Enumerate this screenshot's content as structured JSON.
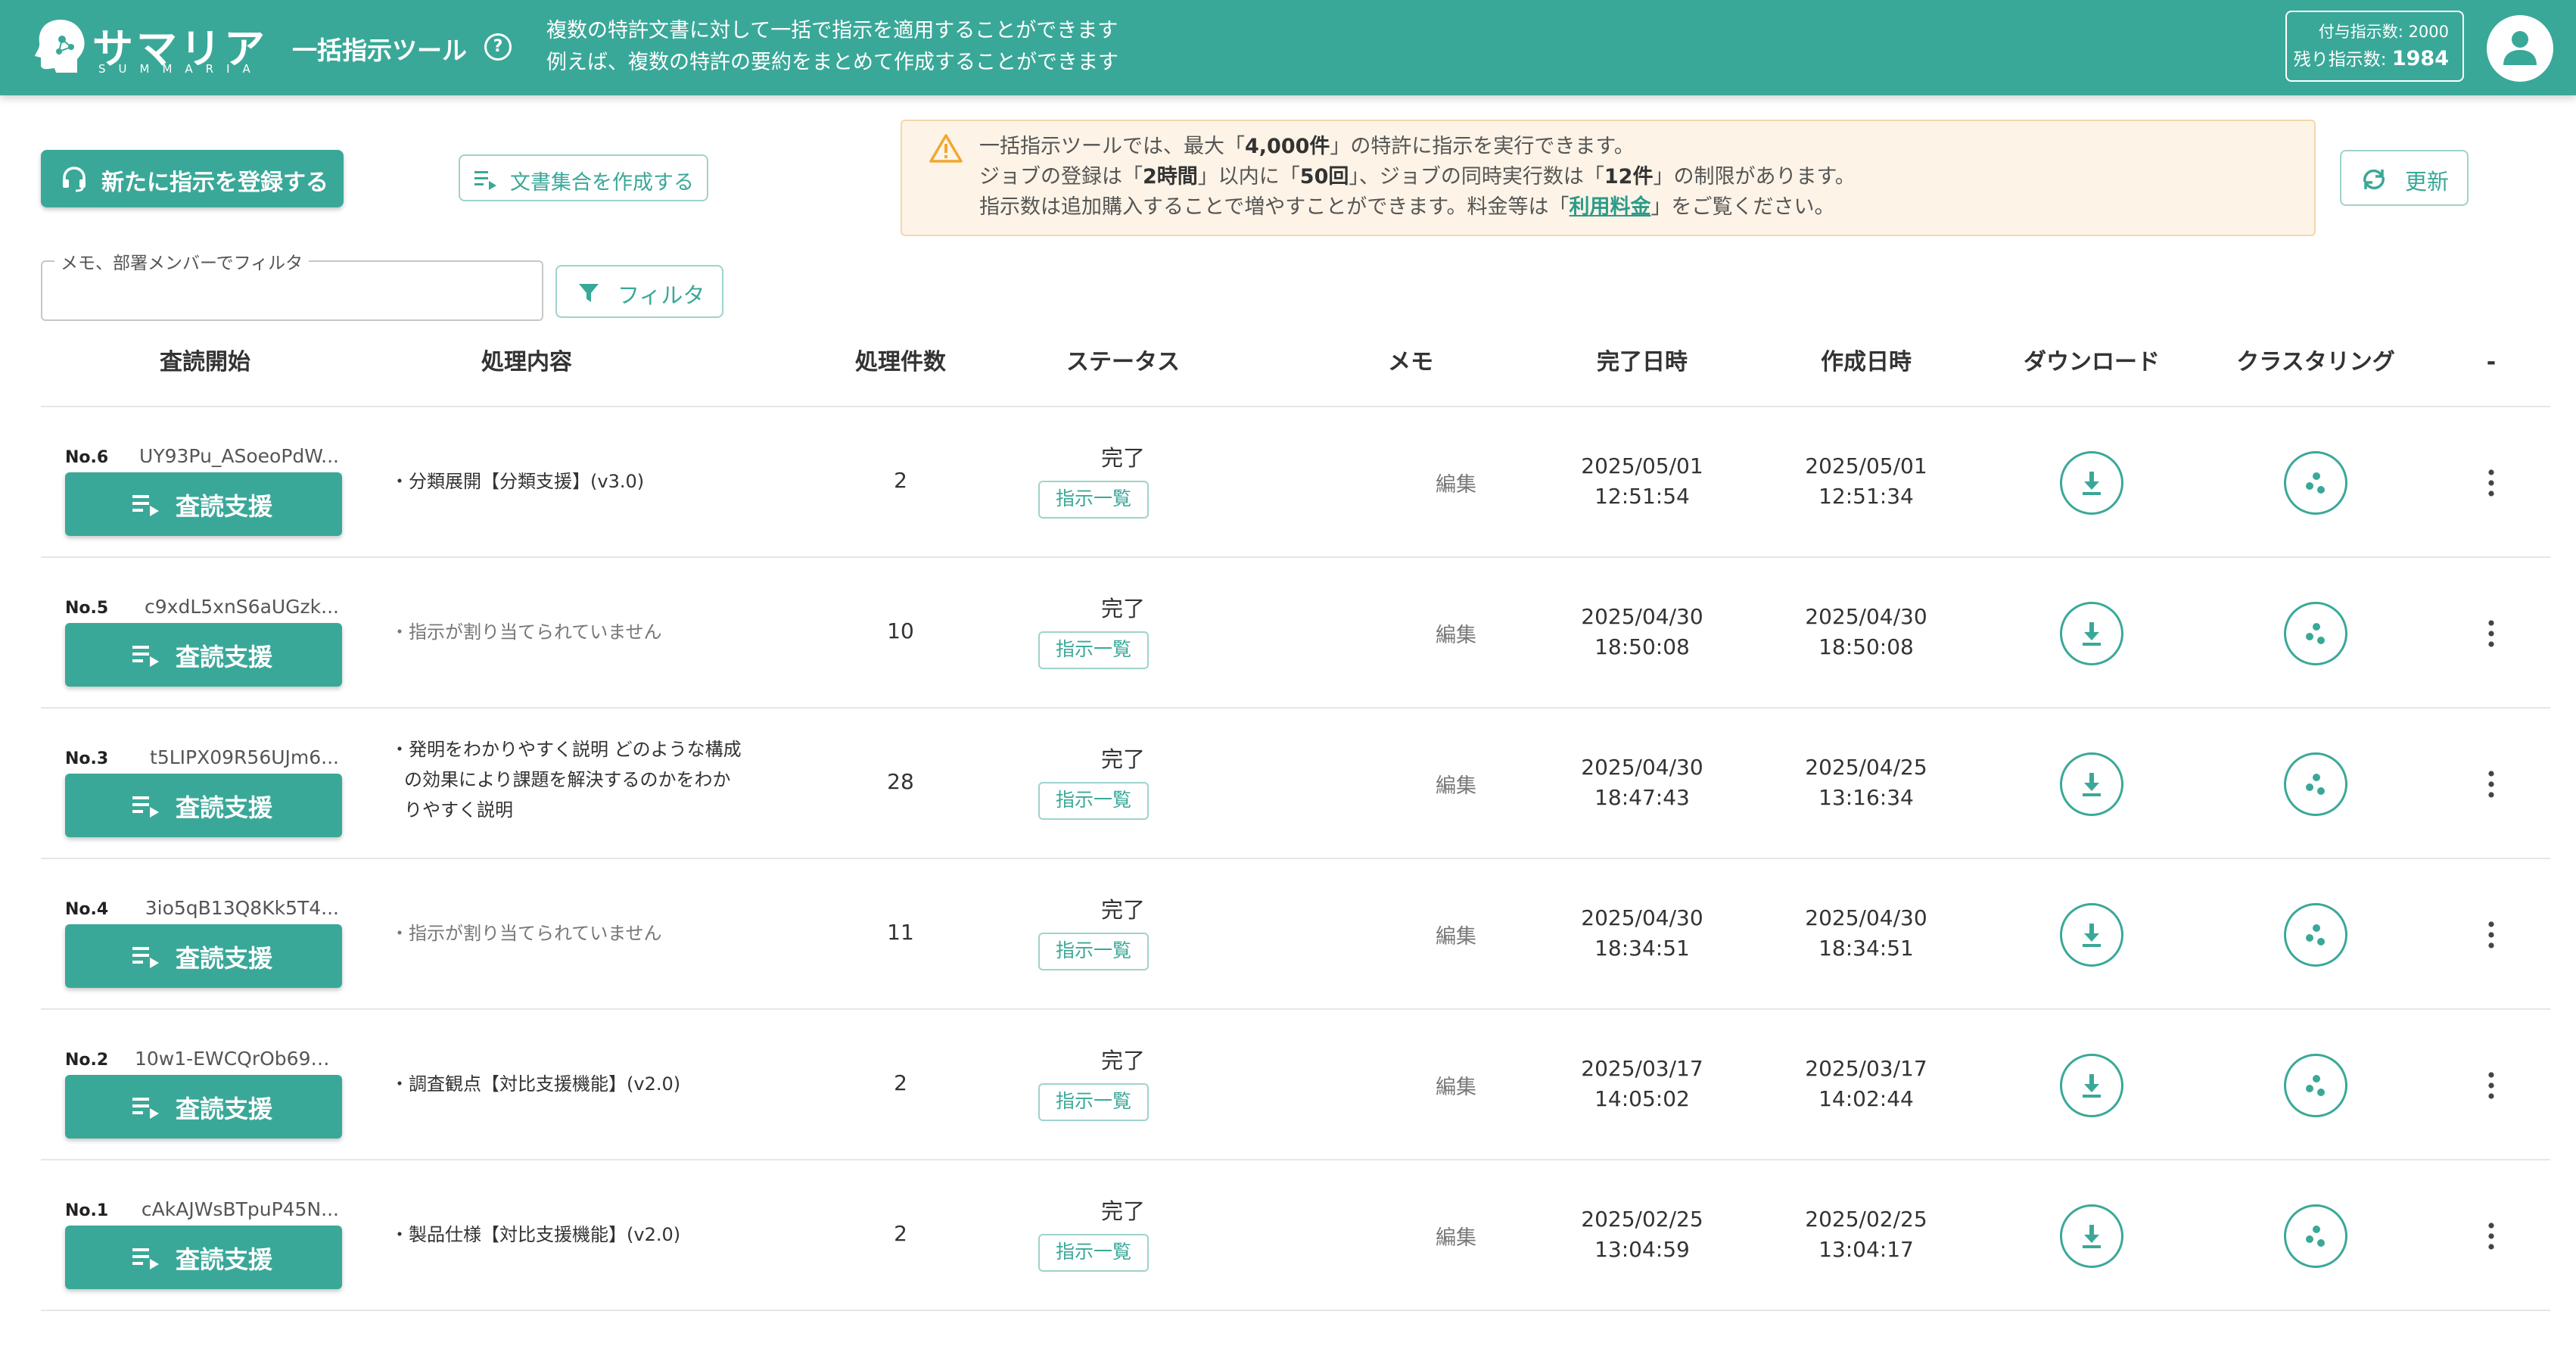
{
  "header": {
    "logo_text": "サマリア",
    "logo_sub": "SUMMARIA",
    "tool_title": "一括指示ツール",
    "desc_line1": "複数の特許文書に対して一括で指示を適用することができます",
    "desc_line2": "例えば、複数の特許の要約をまとめて作成することができます",
    "granted_label": "付与指示数:",
    "granted_value": "2000",
    "remaining_label": "残り指示数:",
    "remaining_value": "1984"
  },
  "actions": {
    "register_label": "新たに指示を登録する",
    "corpus_label": "文書集合を作成する",
    "refresh_label": "更新"
  },
  "notice": {
    "l1_a": "一括指示ツールでは、最大「",
    "l1_b": "4,000件",
    "l1_c": "」の特許に指示を実行できます。",
    "l2_a": "ジョブの登録は「",
    "l2_b": "2時間",
    "l2_c": "」以内に「",
    "l2_d": "50回",
    "l2_e": "」、ジョブの同時実行数は「",
    "l2_f": "12件",
    "l2_g": "」の制限があります。",
    "l3_a": "指示数は追加購入することで増やすことができます。料金等は「",
    "l3_link": "利用料金",
    "l3_c": "」をご覧ください。"
  },
  "filter": {
    "legend": "メモ、部署メンバーでフィルタ",
    "value": "",
    "button_label": "フィルタ"
  },
  "table": {
    "headers": {
      "review_start": "査読開始",
      "content": "処理内容",
      "count": "処理件数",
      "status": "ステータス",
      "memo": "メモ",
      "done_at": "完了日時",
      "created_at": "作成日時",
      "download": "ダウンロード",
      "clustering": "クラスタリング",
      "more": "-"
    },
    "rows": [
      {
        "no": "No.6",
        "job_id": "UY93Pu_ASoeoPdW...",
        "review_label": "査読支援",
        "content": "・分類展開【分類支援】(v3.0)",
        "count": "2",
        "status": "完了",
        "instructions_label": "指示一覧",
        "memo": "編集",
        "done_date": "2025/05/01",
        "done_time": "12:51:54",
        "created_date": "2025/05/01",
        "created_time": "12:51:34"
      },
      {
        "no": "No.5",
        "job_id": "c9xdL5xnS6aUGzk...",
        "review_label": "査読支援",
        "content": "・指示が割り当てられていません",
        "count": "10",
        "status": "完了",
        "instructions_label": "指示一覧",
        "memo": "編集",
        "done_date": "2025/04/30",
        "done_time": "18:50:08",
        "created_date": "2025/04/30",
        "created_time": "18:50:08"
      },
      {
        "no": "No.3",
        "job_id": "t5LIPX09R56UJm6...",
        "review_label": "査読支援",
        "content": "・発明をわかりやすく説明 どのような構成の効果により課題を解決するのかをわかりやすく説明",
        "count": "28",
        "status": "完了",
        "instructions_label": "指示一覧",
        "memo": "編集",
        "done_date": "2025/04/30",
        "done_time": "18:47:43",
        "created_date": "2025/04/25",
        "created_time": "13:16:34"
      },
      {
        "no": "No.4",
        "job_id": "3io5qB13Q8Kk5T4...",
        "review_label": "査読支援",
        "content": "・指示が割り当てられていません",
        "count": "11",
        "status": "完了",
        "instructions_label": "指示一覧",
        "memo": "編集",
        "done_date": "2025/04/30",
        "done_time": "18:34:51",
        "created_date": "2025/04/30",
        "created_time": "18:34:51"
      },
      {
        "no": "No.2",
        "job_id": "10w1-EWCQrOb690...",
        "review_label": "査読支援",
        "content": "・調査観点【対比支援機能】(v2.0)",
        "count": "2",
        "status": "完了",
        "instructions_label": "指示一覧",
        "memo": "編集",
        "done_date": "2025/03/17",
        "done_time": "14:05:02",
        "created_date": "2025/03/17",
        "created_time": "14:02:44"
      },
      {
        "no": "No.1",
        "job_id": "cAkAJWsBTpuP45N...",
        "review_label": "査読支援",
        "content": "・製品仕様【対比支援機能】(v2.0)",
        "count": "2",
        "status": "完了",
        "instructions_label": "指示一覧",
        "memo": "編集",
        "done_date": "2025/02/25",
        "done_time": "13:04:59",
        "created_date": "2025/02/25",
        "created_time": "13:04:17"
      }
    ]
  },
  "colors": {
    "brand": "#3aa898",
    "notice_bg": "#fdf4e7",
    "warning": "#f0a830"
  },
  "icons": {
    "logo": "summaria-head-logo",
    "help": "question-circle-icon",
    "avatar": "user-icon",
    "register": "headset-icon",
    "corpus": "list-arrow-icon",
    "warning": "warning-triangle-icon",
    "refresh": "refresh-icon",
    "filter": "funnel-icon",
    "download": "download-icon",
    "clustering": "cluster-dots-icon",
    "more": "more-vertical-icon"
  }
}
